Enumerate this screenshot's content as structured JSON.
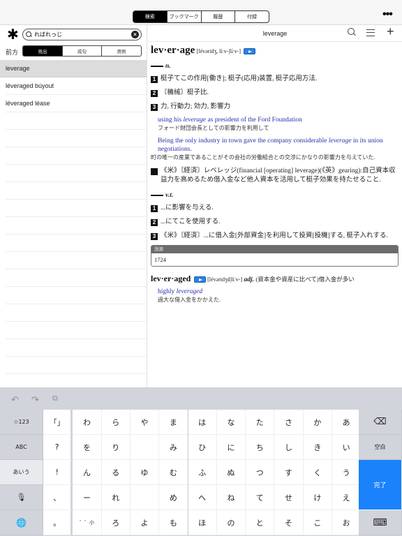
{
  "top_tabs": [
    {
      "label": "検索",
      "active": true
    },
    {
      "label": "ブックマーク",
      "active": false
    },
    {
      "label": "履歴",
      "active": false
    },
    {
      "label": "付録",
      "active": false
    }
  ],
  "more_icon": "ellipsis-icon",
  "left": {
    "asterisk_icon": "asterisk-icon",
    "search": {
      "value": "ればれっじ",
      "placeholder": ""
    },
    "mode_label": "前方",
    "mode_tabs": [
      {
        "label": "見出",
        "active": true
      },
      {
        "label": "成句",
        "active": false
      },
      {
        "label": "用例",
        "active": false
      }
    ],
    "words": [
      "leverage",
      "léveraged búyout",
      "léveraged léase",
      "",
      "",
      "",
      "",
      "",
      "",
      "",
      "",
      "",
      "",
      "",
      "",
      "",
      "",
      "",
      ""
    ]
  },
  "right": {
    "title": "leverage",
    "entry": {
      "headword": "lev·er·age",
      "pron": "[lévəridʒ, líːv-|líːv-]",
      "noun_pos": "n.",
      "noun_senses": [
        "梃子てこの作用[働き]; 梃子(応用)装置, 梃子応用方法.",
        "〘機械〙梃子比.",
        "力, 行動力; 効力, 影響力"
      ],
      "examples": [
        {
          "en_pre": "using his ",
          "en_em": "leverage",
          "en_post": " as president of the Ford Foundation",
          "ja": "フォード財団会長としての影響力を利用して"
        },
        {
          "en_pre": "Being the only industry in town gave the company considerable ",
          "en_em": "leverage",
          "en_post": " in its union negotiations.",
          "ja": "町の唯一の産業であることがその会社の労働組合との交渉にかなりの影響力を与えていた."
        }
      ],
      "noun_sense4": "《米》〘経済〙レベレッジ(financial [operating] leverage)(《英》gearing):自己資本収益力を高めるため借入金など他人資本を活用して梃子効果を持たせること.",
      "verb_pos": "v.t.",
      "verb_senses": [
        "...に影響を与える.",
        "...にてこを使用する.",
        "《米》〘経済〙...に借入金[外部資金]を利用して投資[投機]する, 梃子入れする."
      ],
      "etymology_label": "語源",
      "etymology_value": "1724"
    },
    "entry2": {
      "headword": "lev·er·aged",
      "pron": "[lévəridʒd|líːv-]",
      "pos": "adj.",
      "definition": "(資本金や資産に比べて)借入金が多い",
      "example_pre": "highly ",
      "example_em": "leveraged",
      "example_ja": "過大な借入金をかかえた."
    }
  },
  "keyboard": {
    "tools": [
      "undo-icon",
      "redo-icon",
      "paste-icon"
    ],
    "left_keys": [
      "☆123",
      "ABC",
      "あいう",
      "mic-icon",
      "globe-icon"
    ],
    "grid": [
      [
        "「」",
        "わ",
        "ら",
        "や",
        "ま",
        "は",
        "な",
        "た",
        "さ",
        "か",
        "あ"
      ],
      [
        "?",
        "を",
        "り",
        "",
        "み",
        "ひ",
        "に",
        "ち",
        "し",
        "き",
        "い"
      ],
      [
        "!",
        "ん",
        "る",
        "ゆ",
        "む",
        "ふ",
        "ぬ",
        "つ",
        "す",
        "く",
        "う"
      ],
      [
        "、",
        "ー",
        "れ",
        "",
        "め",
        "へ",
        "ね",
        "て",
        "せ",
        "け",
        "え"
      ],
      [
        "。",
        "゛゜小",
        "ろ",
        "よ",
        "も",
        "ほ",
        "の",
        "と",
        "そ",
        "こ",
        "お"
      ]
    ],
    "right_keys": {
      "delete": "⌫",
      "space": "空白",
      "done": "完了",
      "hide": "keyboard-hide-icon"
    },
    "done_color": "#1a82fb"
  }
}
